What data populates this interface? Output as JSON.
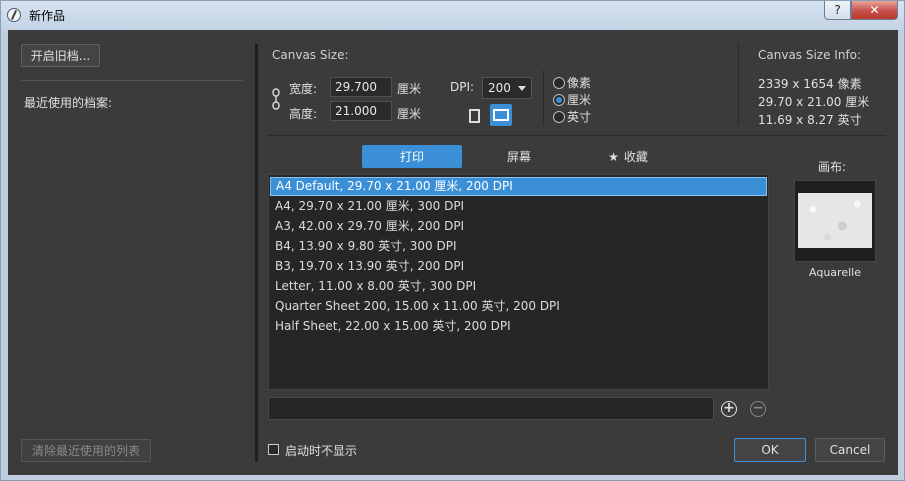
{
  "window": {
    "title": "新作品",
    "help_label": "?",
    "close_label": "✕"
  },
  "left": {
    "open_button": "开启旧档...",
    "recent_label": "最近使用的档案:",
    "clear_button": "清除最近使用的列表"
  },
  "canvas_size": {
    "label": "Canvas Size:",
    "width_label": "宽度:",
    "width_value": "29.700",
    "height_label": "高度:",
    "height_value": "21.000",
    "width_unit": "厘米",
    "height_unit": "厘米",
    "dpi_label": "DPI:",
    "dpi_value": "200",
    "units": [
      {
        "label": "像素",
        "selected": false
      },
      {
        "label": "厘米",
        "selected": true
      },
      {
        "label": "英寸",
        "selected": false
      }
    ]
  },
  "info": {
    "label": "Canvas Size Info:",
    "lines": [
      "2339 x 1654 像素",
      "29.70 x 21.00 厘米",
      "11.69 x 8.27 英寸"
    ]
  },
  "tabs": [
    {
      "label": "打印",
      "active": true
    },
    {
      "label": "屏幕",
      "active": false
    },
    {
      "label": "收藏",
      "active": false,
      "icon": "star-icon"
    }
  ],
  "presets": [
    "A4 Default, 29.70 x 21.00 厘米, 200 DPI",
    "A4, 29.70 x 21.00 厘米, 300 DPI",
    "A3, 42.00 x 29.70 厘米, 200 DPI",
    "B4, 13.90 x 9.80 英寸, 300 DPI",
    "B3, 19.70 x 13.90 英寸, 200 DPI",
    "Letter, 11.00 x 8.00 英寸, 300 DPI",
    "Quarter Sheet 200, 15.00 x 11.00 英寸, 200 DPI",
    "Half Sheet, 22.00 x 15.00 英寸, 200 DPI"
  ],
  "selected_preset": 0,
  "canvas_paper": {
    "label": "画布:",
    "name": "Aquarelle"
  },
  "footer": {
    "dont_show_label": "启动时不显示",
    "dont_show_checked": false,
    "ok_label": "OK",
    "cancel_label": "Cancel"
  },
  "colors": {
    "accent": "#3b8fd6",
    "background": "#3b3b3b"
  }
}
